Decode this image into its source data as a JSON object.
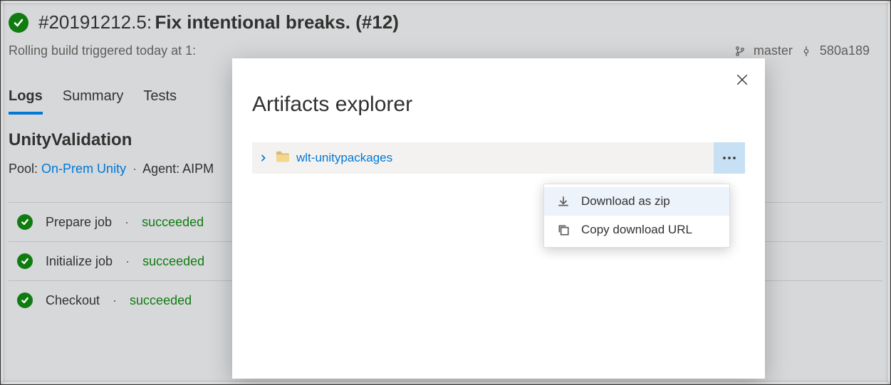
{
  "header": {
    "build_id": "#20191212.5:",
    "build_title": "Fix intentional breaks. (#12)",
    "subtitle": "Rolling build triggered today at 1:",
    "branch": "master",
    "commit": "580a189"
  },
  "tabs": {
    "logs": "Logs",
    "summary": "Summary",
    "tests": "Tests"
  },
  "job": {
    "title": "UnityValidation",
    "pool_label": "Pool:",
    "pool_name": "On-Prem Unity",
    "agent_label": "Agent: AIPM"
  },
  "steps": [
    {
      "name": "Prepare job",
      "status": "succeeded"
    },
    {
      "name": "Initialize job",
      "status": "succeeded"
    },
    {
      "name": "Checkout",
      "status": "succeeded"
    }
  ],
  "modal": {
    "title": "Artifacts explorer",
    "artifact_name": "wlt-unitypackages"
  },
  "menu": {
    "download": "Download as zip",
    "copy": "Copy download URL"
  }
}
